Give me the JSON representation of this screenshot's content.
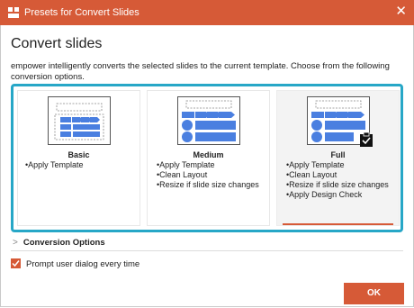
{
  "window": {
    "title": "Presets for Convert Slides",
    "close_symbol": "✕",
    "accent_color": "#d65a37"
  },
  "heading": "Convert slides",
  "description": "empower intelligently converts the selected slides to the current template. Choose from the following conversion options.",
  "presets": [
    {
      "name": "Basic",
      "features": [
        "Apply Template"
      ],
      "selected": false
    },
    {
      "name": "Medium",
      "features": [
        "Apply Template",
        "Clean Layout",
        "Resize if slide size changes"
      ],
      "selected": false
    },
    {
      "name": "Full",
      "features": [
        "Apply Template",
        "Clean Layout",
        "Resize if slide size changes",
        "Apply Design Check"
      ],
      "selected": true
    }
  ],
  "selection_frame_color": "#27a7c7",
  "conversion_options": {
    "label": "Conversion Options",
    "expanded": false
  },
  "prompt_checkbox": {
    "label": "Prompt user dialog every time",
    "checked": true
  },
  "ok_button": {
    "label": "OK"
  }
}
